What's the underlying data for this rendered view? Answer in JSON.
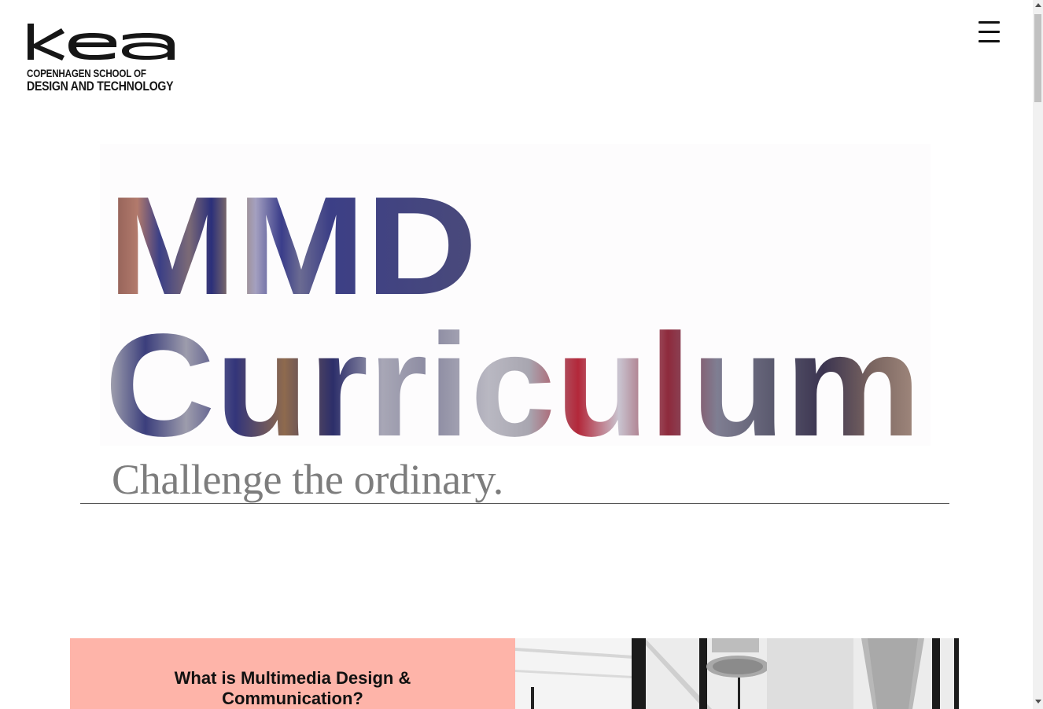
{
  "header": {
    "logo_text": "kea",
    "logo_subtitle_line1": "COPENHAGEN SCHOOL OF",
    "logo_subtitle_line2": "DESIGN AND TECHNOLOGY",
    "menu_icon": "hamburger-icon"
  },
  "hero": {
    "title_line1": "MMD",
    "title_line2": "Curriculum",
    "tagline": "Challenge the ordinary."
  },
  "intro": {
    "card_title": "What is Multimedia Design & Communication?"
  },
  "colors": {
    "card_background": "#feb4a9",
    "tagline": "#7d7d7d",
    "text": "#111111"
  }
}
